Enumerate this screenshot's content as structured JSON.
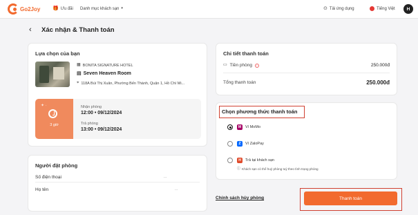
{
  "header": {
    "logo": "Go2Joy",
    "nav": [
      {
        "label": "Ưu đãi",
        "icon": "gift-icon"
      },
      {
        "label": "Danh mục khách sạn",
        "icon": "chevron-down-icon"
      }
    ],
    "download_app": "Tải ứng dụng",
    "language": "Tiếng Việt",
    "avatar": "H"
  },
  "page": {
    "title": "Xác nhận & Thanh toán"
  },
  "selection": {
    "title": "Lựa chọn của bạn",
    "hotel_name": "BONITA SIGNATURE HOTEL",
    "room_name": "Seven Heaven Room",
    "address": "118A Bùi Thị Xuân, Phường Bến Thành, Quận 1, Hồ Chí Mi...",
    "duration": "3 giờ",
    "checkin_label": "Nhận phòng",
    "checkin_value": "12:00 • 09/12/2024",
    "checkout_label": "Trả phòng",
    "checkout_value": "13:00 • 09/12/2024"
  },
  "booker": {
    "title": "Người đặt phòng",
    "phone_label": "Số điện thoại",
    "phone_value": "...",
    "name_label": "Họ tên",
    "name_value": "..."
  },
  "payment_detail": {
    "title": "Chi tiết thanh toán",
    "room_price_label": "Tiền phòng",
    "room_price_value": "250.000đ",
    "total_label": "Tổng thanh toán",
    "total_value": "250.000đ"
  },
  "payment_method": {
    "title": "Chọn phương thức thanh toán",
    "options": [
      {
        "label": "Ví MoMo",
        "icon": "momo-icon",
        "color": "#a50064",
        "selected": true
      },
      {
        "label": "Ví ZaloPay",
        "icon": "zalopay-icon",
        "color": "#0068ff",
        "selected": false
      },
      {
        "label": "Trả tại khách sạn",
        "icon": "hotel-icon",
        "color": "#e04a2a",
        "selected": false
      }
    ],
    "note": "Khách sạn có thể huỷ phòng tuỳ theo tình trạng phòng"
  },
  "footer": {
    "cancel_policy": "Chính sách hủy phòng",
    "pay_button": "Thanh toán"
  },
  "colors": {
    "accent": "#f26a2e",
    "highlight": "#d04030"
  }
}
